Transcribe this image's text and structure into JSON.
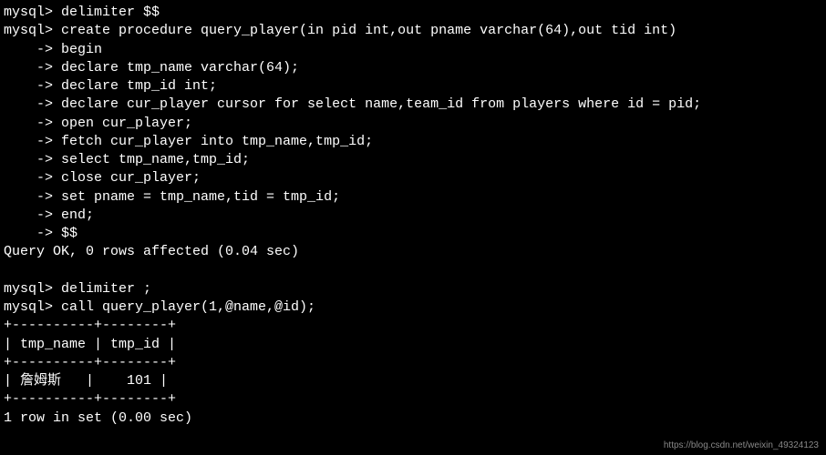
{
  "prompts": {
    "mysql": "mysql> ",
    "cont": "    -> "
  },
  "commands": {
    "delimiter_open": "delimiter $$",
    "create_proc": "create procedure query_player(in pid int,out pname varchar(64),out tid int)",
    "begin": "begin",
    "declare_tmp_name": "declare tmp_name varchar(64);",
    "declare_tmp_id": "declare tmp_id int;",
    "declare_cursor": "declare cur_player cursor for select name,team_id from players where id = pid;",
    "open_cursor": "open cur_player;",
    "fetch_cursor": "fetch cur_player into tmp_name,tmp_id;",
    "select_vals": "select tmp_name,tmp_id;",
    "close_cursor": "close cur_player;",
    "set_out": "set pname = tmp_name,tid = tmp_id;",
    "end": "end;",
    "delim_end": "$$",
    "delimiter_close": "delimiter ;",
    "call_proc": "call query_player(1,@name,@id);"
  },
  "result": {
    "query_ok": "Query OK, 0 rows affected (0.04 sec)",
    "table": {
      "border": "+----------+--------+",
      "header": "| tmp_name | tmp_id |",
      "row": "| 詹姆斯   |    101 |"
    },
    "row_count": "1 row in set (0.00 sec)"
  },
  "watermark": "https://blog.csdn.net/weixin_49324123"
}
